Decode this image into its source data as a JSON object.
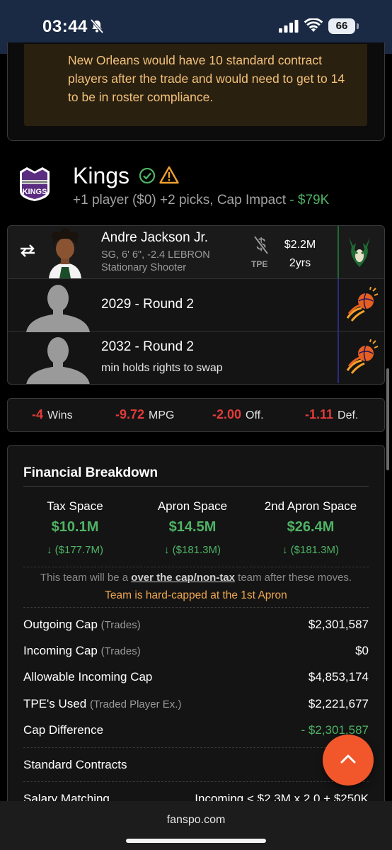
{
  "status_bar": {
    "time": "03:44",
    "battery": "66"
  },
  "note": {
    "text": "New Orleans would have 10 standard contract players after the trade and would need to get to 14 to be in roster compliance."
  },
  "team": {
    "name": "Kings",
    "summary": "+1 player ($0) +2 picks, Cap Impact",
    "cap_impact": "- $79K",
    "colors": {
      "kings": "#5a2d81",
      "bucks": "#00471b",
      "suns": "#1d1160"
    }
  },
  "players": [
    {
      "name": "Andre Jackson Jr.",
      "info": "SG, 6' 6\", -2.4 LEBRON",
      "role": "Stationary Shooter",
      "tpe_label": "TPE",
      "salary": "$2.2M",
      "years": "2yrs",
      "from_team_icon": "bucks-logo-icon"
    },
    {
      "pick": "2029 - Round 2",
      "from_team_icon": "suns-logo-icon"
    },
    {
      "pick": "2032 - Round 2",
      "note": "min holds rights to swap",
      "from_team_icon": "suns-logo-icon"
    }
  ],
  "stats": [
    {
      "value": "-4",
      "label": "Wins"
    },
    {
      "value": "-9.72",
      "label": "MPG"
    },
    {
      "value": "-2.00",
      "label": "Off."
    },
    {
      "value": "-1.11",
      "label": "Def."
    }
  ],
  "financial": {
    "title": "Financial Breakdown",
    "spaces": [
      {
        "label": "Tax Space",
        "value": "$10.1M",
        "delta": "($177.7M)"
      },
      {
        "label": "Apron Space",
        "value": "$14.5M",
        "delta": "($181.3M)"
      },
      {
        "label": "2nd Apron Space",
        "value": "$26.4M",
        "delta": "($181.3M)"
      }
    ],
    "team_note_prefix": "This team will be a",
    "team_note_link": "over the cap/non-tax",
    "team_note_suffix": "team after these moves.",
    "hardcap": "Team is hard-capped at the 1st Apron",
    "rows": [
      {
        "label": "Outgoing Cap",
        "sub": "(Trades)",
        "value": "$2,301,587"
      },
      {
        "label": "Incoming Cap",
        "sub": "(Trades)",
        "value": "$0"
      },
      {
        "label": "Allowable Incoming Cap",
        "sub": "",
        "value": "$4,853,174"
      },
      {
        "label": "TPE's Used",
        "sub": "(Traded Player Ex.)",
        "value": "$2,221,677"
      },
      {
        "label": "Cap Difference",
        "sub": "",
        "value": "- $2,301,587"
      },
      {
        "label": "Standard Contracts",
        "sub": "",
        "value": ""
      },
      {
        "label": "Salary Matching",
        "sub": "",
        "value": "Incoming < $2.3M x 2.0 + $250K"
      }
    ]
  },
  "browser": {
    "url": "fanspo.com"
  }
}
